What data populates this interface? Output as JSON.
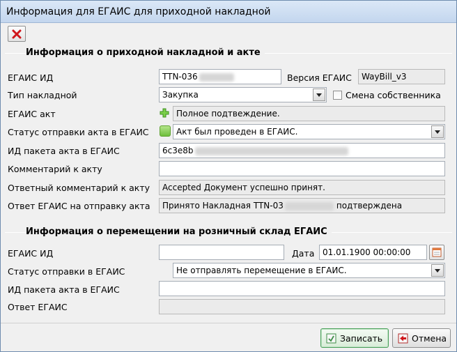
{
  "window": {
    "title": "Информация для ЕГАИС для приходной накладной"
  },
  "toolbar": {
    "delete_icon": "red-x-icon"
  },
  "invoice_section": {
    "title": "Информация о приходной накладной и акте",
    "egais_id_label": "ЕГАИС ИД",
    "egais_id_value": "TTN-036",
    "egais_version_label": "Версия ЕГАИС",
    "egais_version_value": "WayBill_v3",
    "invoice_type_label": "Тип накладной",
    "invoice_type_value": "Закупка",
    "owner_change_label": "Смена собственника",
    "owner_change_checked": false,
    "egais_act_label": "ЕГАИС акт",
    "egais_act_value": "Полное подтвеждение.",
    "act_status_label": "Статус отправки акта в ЕГАИС",
    "act_status_value": "Акт был проведен в ЕГАИС.",
    "act_package_label": "ИД пакета акта в ЕГАИС",
    "act_package_value": "6c3e8b",
    "act_comment_label": "Комментарий к акту",
    "act_comment_value": "",
    "reply_comment_label": "Ответный комментарий к акту",
    "reply_comment_value": "Accepted Документ успешно принят.",
    "egais_reply_label": "Ответ ЕГАИС на отправку акта",
    "egais_reply_prefix": "Принято Накладная TTN-03",
    "egais_reply_suffix": "подтверждена"
  },
  "transfer_section": {
    "title": "Информация о перемещении на розничный склад ЕГАИС",
    "egais_id_label": "ЕГАИС ИД",
    "egais_id_value": "",
    "date_label": "Дата",
    "date_value": "01.01.1900 00:00:00",
    "send_status_label": "Статус отправки в ЕГАИС",
    "send_status_value": "Не отправлять перемещение в ЕГАИС.",
    "act_package_label": "ИД пакета акта в ЕГАИС",
    "act_package_value": "",
    "egais_reply_label": "Ответ ЕГАИС",
    "egais_reply_value": ""
  },
  "footer": {
    "save_label": "Записать",
    "cancel_label": "Отмена"
  },
  "colors": {
    "status_ok": "#6fbf3c",
    "delete_red": "#d0161b",
    "titlebar": "#c3d6ee"
  }
}
